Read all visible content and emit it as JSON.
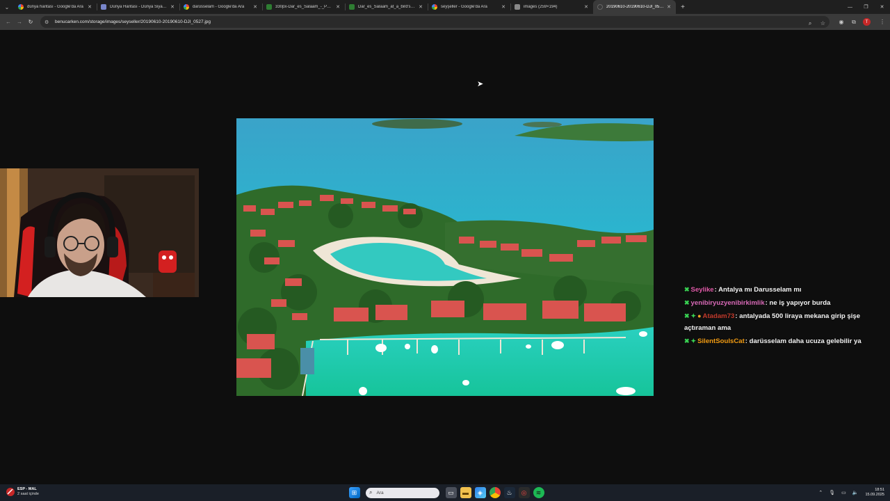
{
  "browser": {
    "tabs": [
      {
        "title": "dünya haritası - Google'da Ara",
        "favicon": "google-icon",
        "active": false
      },
      {
        "title": "Dünya Haritası - Dünya Siyasi Ha...",
        "favicon": "site-icon",
        "active": false
      },
      {
        "title": "darüsselam - Google'da Ara",
        "favicon": "google-icon",
        "active": false
      },
      {
        "title": "330px-Dar_es_Salaam_-_Posta...",
        "favicon": "wikipedia-icon",
        "active": false
      },
      {
        "title": "Dar_es_Salaam_at_a_bird's_view...",
        "favicon": "wikipedia-icon",
        "active": false
      },
      {
        "title": "seyşeller - Google'da Ara",
        "favicon": "google-icon",
        "active": false
      },
      {
        "title": "images (259×194)",
        "favicon": "image-icon",
        "active": false
      },
      {
        "title": "20190610-20190610-DJI_0527...",
        "favicon": "blank-icon",
        "active": true
      }
    ],
    "url": "benucarken.com/storage/images/seyseller/20190610-20190610-DJI_0527.jpg",
    "profile_initial": "T"
  },
  "photo": {
    "description_icon": "aerial-photo-image",
    "colors": {
      "sea": "#2bb7c9",
      "lagoon": "#29c7a8",
      "roof": "#d9544f",
      "trees": "#2f6b2a",
      "sand": "#efe6d6"
    }
  },
  "webcam": {
    "icon": "webcam-feed-image"
  },
  "chat": {
    "messages": [
      {
        "badges": [
          "green-sword"
        ],
        "user": "Seylike",
        "user_color": "#e05aa8",
        "text": ": Antalya mı Darusselam mı"
      },
      {
        "badges": [
          "green-sword"
        ],
        "user": "yenibiryuzyenibirkimlik",
        "user_color": "#d96ab8",
        "text": ": ne iş yapıyor burda"
      },
      {
        "badges": [
          "green-sword",
          "green-diamond",
          "gold-circle"
        ],
        "user": "Atadam73",
        "user_color": "#c0392b",
        "text": ": antalyada 500 liraya mekana girip şişe açtıraman ama"
      },
      {
        "badges": [
          "green-sword",
          "green-diamond"
        ],
        "user": "SilentSoulsCat",
        "user_color": "#f39c12",
        "text": ": darüsselam daha ucuza gelebilir ya"
      }
    ]
  },
  "taskbar": {
    "weather_title": "ESP - MAL",
    "weather_sub": "2 saat içinde",
    "search_placeholder": "Ara",
    "time": "18:51",
    "date": "15.09.2025"
  }
}
